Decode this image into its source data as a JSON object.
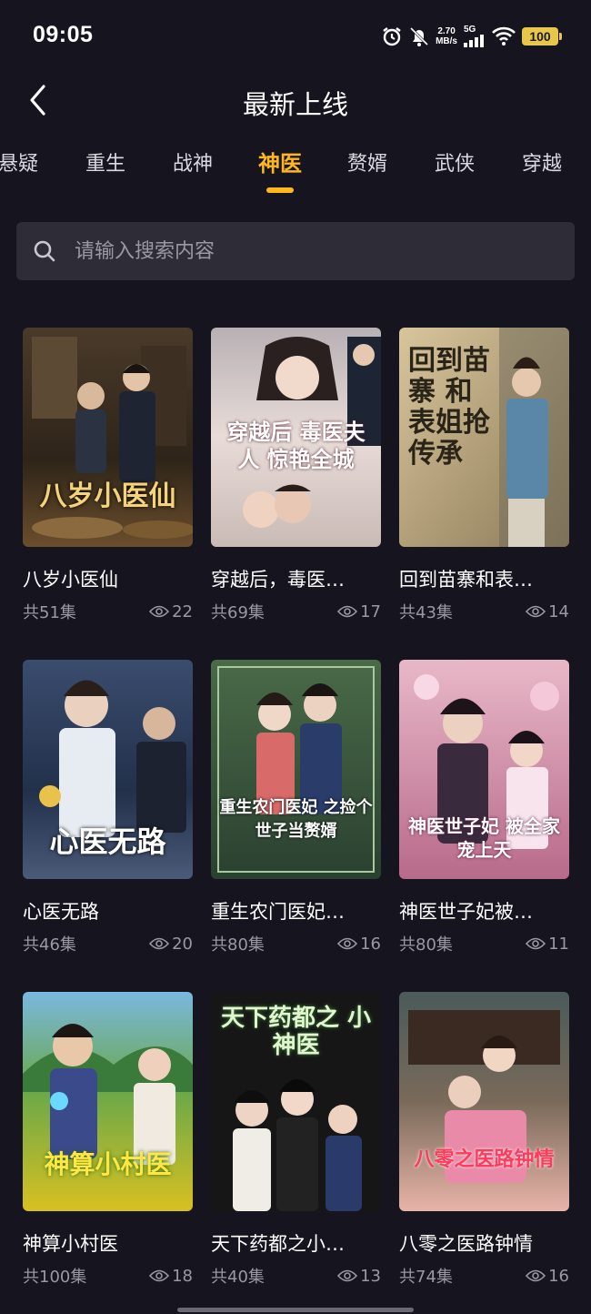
{
  "status_bar": {
    "time": "09:05",
    "net_speed_value": "2.70",
    "net_speed_unit": "MB/s",
    "network": "5G",
    "battery": "100"
  },
  "header": {
    "title": "最新上线",
    "back_icon": "chevron-left-icon"
  },
  "tabs": [
    {
      "label": "悬疑",
      "active": false
    },
    {
      "label": "重生",
      "active": false
    },
    {
      "label": "战神",
      "active": false
    },
    {
      "label": "神医",
      "active": true
    },
    {
      "label": "赘婿",
      "active": false
    },
    {
      "label": "武侠",
      "active": false
    },
    {
      "label": "穿越",
      "active": false
    }
  ],
  "search": {
    "placeholder": "请输入搜索内容",
    "icon": "search-icon"
  },
  "cards": [
    {
      "title": "八岁小医仙",
      "episodes": "共51集",
      "views": "22",
      "poster_text": "八岁小医仙"
    },
    {
      "title": "穿越后，毒医…",
      "episodes": "共69集",
      "views": "17",
      "poster_text": "穿越后 毒医夫人 惊艳全城"
    },
    {
      "title": "回到苗寨和表…",
      "episodes": "共43集",
      "views": "14",
      "poster_text": "回到苗寨 和表姐抢传承"
    },
    {
      "title": "心医无路",
      "episodes": "共46集",
      "views": "20",
      "poster_text": "心医无路"
    },
    {
      "title": "重生农门医妃…",
      "episodes": "共80集",
      "views": "16",
      "poster_text": "重生农门医妃 之捡个世子当赘婿"
    },
    {
      "title": "神医世子妃被…",
      "episodes": "共80集",
      "views": "11",
      "poster_text": "神医世子妃 被全家宠上天"
    },
    {
      "title": "神算小村医",
      "episodes": "共100集",
      "views": "18",
      "poster_text": "神算小村医"
    },
    {
      "title": "天下药都之小…",
      "episodes": "共40集",
      "views": "13",
      "poster_text": "天下药都之 小神医"
    },
    {
      "title": "八零之医路钟情",
      "episodes": "共74集",
      "views": "16",
      "poster_text": "八零之医路钟情"
    }
  ],
  "colors": {
    "background": "#15141f",
    "accent": "#ffb71b",
    "search_bg": "#2d2c37",
    "muted_text": "#9a99a3"
  }
}
